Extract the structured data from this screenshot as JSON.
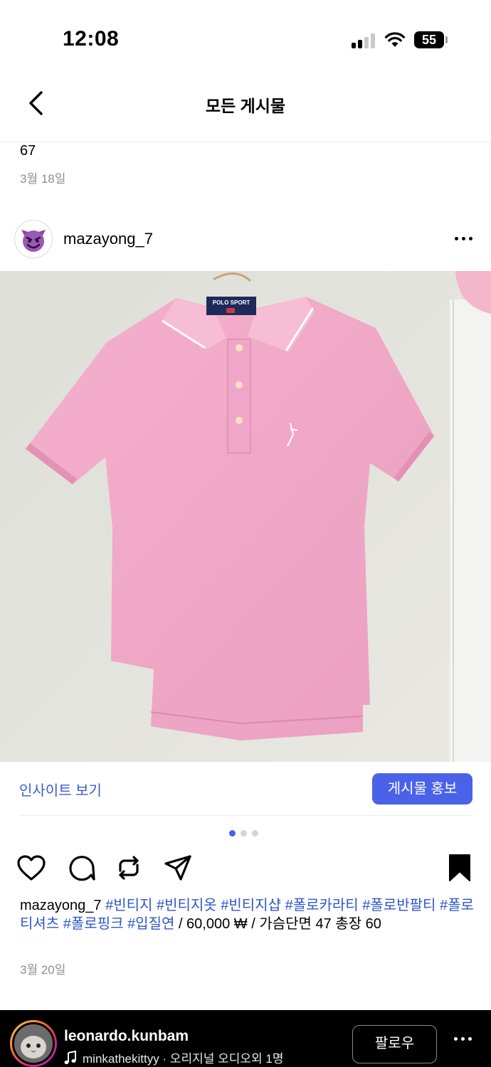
{
  "status_bar": {
    "time": "12:08",
    "battery": "55"
  },
  "nav": {
    "title": "모든 게시물",
    "back_icon": "chevron-left-icon"
  },
  "previous_post": {
    "text": "67",
    "date": "3월 18일"
  },
  "post": {
    "username": "mazayong_7",
    "avatar_icon": "smiling-devil-emoji",
    "insights_label": "인사이트 보기",
    "promote_label": "게시물 홍보",
    "carousel": {
      "count": 3,
      "active_index": 0
    },
    "actions": {
      "like_icon": "heart-icon",
      "comment_icon": "comment-icon",
      "repost_icon": "repost-icon",
      "share_icon": "send-icon",
      "save_icon": "bookmark-filled-icon"
    },
    "caption": {
      "username": "mazayong_7",
      "hashtags": [
        "#빈티지",
        "#빈티지옷",
        "#빈티지샵",
        "#폴로카라티",
        "#폴로반팔티",
        "#폴로티셔츠",
        "#폴로핑크",
        "#입질연"
      ],
      "text": " / 60,000 ₩ / 가슴단면 47 총장 60"
    },
    "date": "3월 20일",
    "photo_label": "POLO SPORT"
  },
  "reel_bar": {
    "username": "leonardo.kunbam",
    "audio_text": "minkathekittyy · 오리지널 오디오외 1명",
    "follow_label": "팔로우"
  },
  "colors": {
    "accent": "#4a62e8",
    "hashtag": "#2d56c9",
    "shirt": "#f0a8c6",
    "wall": "#e3e3dd"
  }
}
